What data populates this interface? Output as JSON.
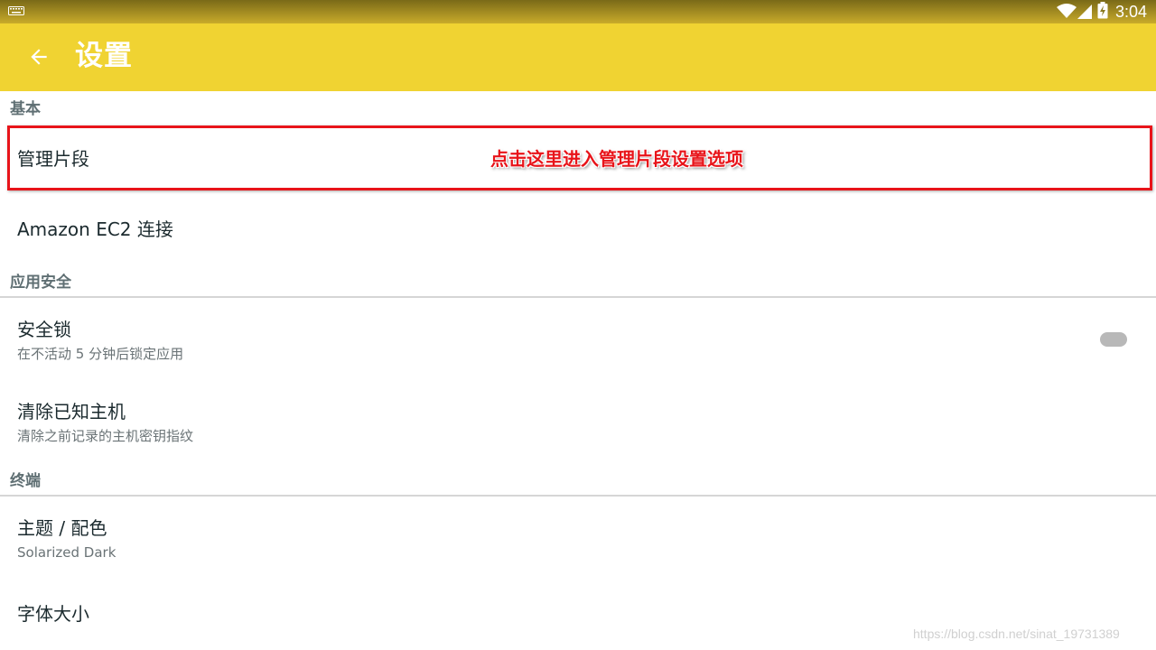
{
  "status_bar": {
    "time": "3:04",
    "icons": [
      "keyboard-icon",
      "wifi-icon",
      "signal-icon",
      "battery-charging-icon"
    ]
  },
  "app_bar": {
    "title": "设置",
    "back_icon": "arrow-left-icon",
    "color": "#f0d332"
  },
  "sections": {
    "basic": {
      "header": "基本",
      "items": [
        {
          "title": "管理片段"
        },
        {
          "title": "Amazon EC2 连接"
        }
      ]
    },
    "security": {
      "header": "应用安全",
      "items": [
        {
          "title": "安全锁",
          "summary": "在不活动 5 分钟后锁定应用",
          "toggle": false
        },
        {
          "title": "清除已知主机",
          "summary": "清除之前记录的主机密钥指纹"
        }
      ]
    },
    "terminal": {
      "header": "终端",
      "items": [
        {
          "title": "主题 / 配色",
          "summary": "Solarized Dark"
        },
        {
          "title": "字体大小"
        }
      ]
    }
  },
  "annotation": {
    "text": "点击这里进入管理片段设置选项",
    "color": "#e8141a"
  },
  "watermark": "https://blog.csdn.net/sinat_19731389"
}
